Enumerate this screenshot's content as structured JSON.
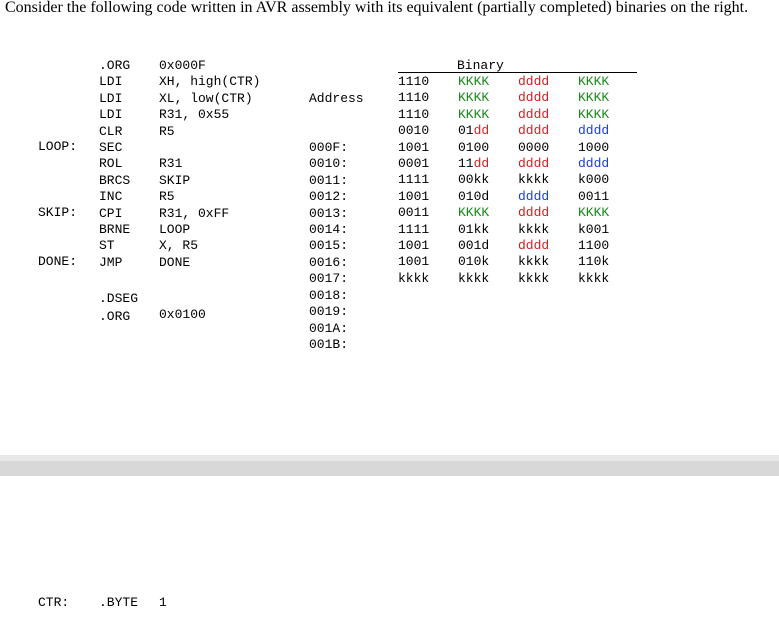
{
  "intro": "Consider the following code written in AVR assembly with its equivalent (partially completed) binaries on the right.",
  "labels": [
    "LOOP:",
    "",
    "",
    "",
    "SKIP:",
    "",
    "",
    "DONE:"
  ],
  "mnemonics": [
    ".ORG",
    "LDI",
    "LDI",
    "LDI",
    "CLR",
    "SEC",
    "ROL",
    "BRCS",
    "INC",
    "CPI",
    "BRNE",
    "ST",
    "JMP"
  ],
  "operands": [
    "0x000F",
    "XH, high(CTR)",
    "XL, low(CTR)",
    "R31, 0x55",
    "R5",
    "",
    "R31",
    "SKIP",
    "R5",
    "R31, 0xFF",
    "LOOP",
    "X, R5",
    "DONE"
  ],
  "address_header": "Address",
  "addresses": [
    "000F:",
    "0010:",
    "0011:",
    "0012:",
    "0013:",
    "0014:",
    "0015:",
    "0016:",
    "0017:",
    "0018:",
    "0019:",
    "001A:",
    "001B:"
  ],
  "binary_header": "Binary",
  "binary_rows": [
    [
      {
        "t": "1110",
        "c": "k"
      },
      {
        "t": "KKKK",
        "c": "g"
      },
      {
        "t": "dddd",
        "c": "r"
      },
      {
        "t": "KKKK",
        "c": "g"
      }
    ],
    [
      {
        "t": "1110",
        "c": "k"
      },
      {
        "t": "KKKK",
        "c": "g"
      },
      {
        "t": "dddd",
        "c": "r"
      },
      {
        "t": "KKKK",
        "c": "g"
      }
    ],
    [
      {
        "t": "1110",
        "c": "k"
      },
      {
        "t": "KKKK",
        "c": "g"
      },
      {
        "t": "dddd",
        "c": "r"
      },
      {
        "t": "KKKK",
        "c": "g"
      }
    ],
    [
      {
        "t": "0010",
        "c": "k"
      },
      {
        "t": "01dd",
        "c": "mixed",
        "parts": [
          {
            "t": "01",
            "c": "k"
          },
          {
            "t": "dd",
            "c": "r"
          }
        ]
      },
      {
        "t": "dddd",
        "c": "r"
      },
      {
        "t": "dddd",
        "c": "b"
      }
    ],
    [
      {
        "t": "1001",
        "c": "k"
      },
      {
        "t": "0100",
        "c": "k"
      },
      {
        "t": "0000",
        "c": "k"
      },
      {
        "t": "1000",
        "c": "k"
      }
    ],
    [
      {
        "t": "0001",
        "c": "k"
      },
      {
        "t": "11dd",
        "c": "mixed",
        "parts": [
          {
            "t": "11",
            "c": "k"
          },
          {
            "t": "dd",
            "c": "r"
          }
        ]
      },
      {
        "t": "dddd",
        "c": "r"
      },
      {
        "t": "dddd",
        "c": "b"
      }
    ],
    [
      {
        "t": "1111",
        "c": "k"
      },
      {
        "t": "00kk",
        "c": "k"
      },
      {
        "t": "kkkk",
        "c": "k"
      },
      {
        "t": "k000",
        "c": "k"
      }
    ],
    [
      {
        "t": "1001",
        "c": "k"
      },
      {
        "t": "010d",
        "c": "k"
      },
      {
        "t": "dddd",
        "c": "b"
      },
      {
        "t": "0011",
        "c": "k"
      }
    ],
    [
      {
        "t": "0011",
        "c": "k"
      },
      {
        "t": "KKKK",
        "c": "g"
      },
      {
        "t": "dddd",
        "c": "r"
      },
      {
        "t": "KKKK",
        "c": "g"
      }
    ],
    [
      {
        "t": "1111",
        "c": "k"
      },
      {
        "t": "01kk",
        "c": "k"
      },
      {
        "t": "kkkk",
        "c": "k"
      },
      {
        "t": "k001",
        "c": "k"
      }
    ],
    [
      {
        "t": "1001",
        "c": "k"
      },
      {
        "t": "001d",
        "c": "k"
      },
      {
        "t": "dddd",
        "c": "r"
      },
      {
        "t": "1100",
        "c": "k"
      }
    ],
    [
      {
        "t": "1001",
        "c": "k"
      },
      {
        "t": "010k",
        "c": "k"
      },
      {
        "t": "kkkk",
        "c": "k"
      },
      {
        "t": "110k",
        "c": "k"
      }
    ],
    [
      {
        "t": "kkkk",
        "c": "k"
      },
      {
        "t": "kkkk",
        "c": "k"
      },
      {
        "t": "kkkk",
        "c": "k"
      },
      {
        "t": "kkkk",
        "c": "k"
      }
    ]
  ],
  "dseg": {
    "line1": ".DSEG",
    "line2": ".ORG",
    "org_value": "0x0100"
  },
  "ctr": {
    "label": "CTR:",
    "directive": ".BYTE",
    "value": "1"
  },
  "colors": {
    "green": "#1a8a1a",
    "red": "#d42020",
    "blue": "#1a3fd6"
  }
}
